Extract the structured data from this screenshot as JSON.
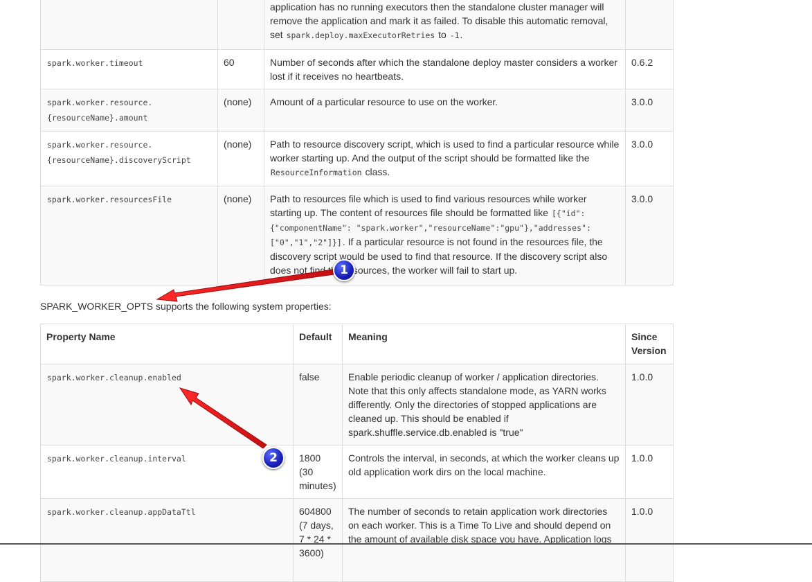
{
  "table1": {
    "partial_row": {
      "line1": "application has no running executors then the standalone cluster manager will",
      "line2": "remove the application and mark it as failed. To disable this automatic removal,",
      "set_word": "set",
      "code1": "spark.deploy.maxExecutorRetries",
      "to_word": "to",
      "code2": "-1",
      "end": "."
    },
    "rows": [
      {
        "name": "spark.worker.timeout",
        "default": "60",
        "meaning": "Number of seconds after which the standalone deploy master considers a worker lost if it receives no heartbeats.",
        "since": "0.6.2"
      },
      {
        "name_line1": "spark.worker.resource.",
        "name_line2": "{resourceName}.amount",
        "default": "(none)",
        "meaning": "Amount of a particular resource to use on the worker.",
        "since": "3.0.0"
      },
      {
        "name_line1": "spark.worker.resource.",
        "name_line2": "{resourceName}.discoveryScript",
        "default": "(none)",
        "meaning_before": "Path to resource discovery script, which is used to find a particular resource while worker starting up. And the output of the script should be formatted like the ",
        "meaning_code": "ResourceInformation",
        "meaning_after": " class.",
        "since": "3.0.0"
      },
      {
        "name": "spark.worker.resourcesFile",
        "default": "(none)",
        "meaning_before": "Path to resources file which is used to find various resources while worker starting up. The content of resources file should be formatted like ",
        "meaning_code": "[{\"id\":{\"componentName\": \"spark.worker\",\"resourceName\":\"gpu\"},\"addresses\":[\"0\",\"1\",\"2\"]}]",
        "meaning_after": ". If a particular resource is not found in the resources file, the discovery script would be used to find that resource. If the discovery script also does not find the resources, the worker will fail to start up.",
        "since": "3.0.0"
      }
    ]
  },
  "intro_text": "SPARK_WORKER_OPTS supports the following system properties:",
  "table2": {
    "headers": {
      "name": "Property Name",
      "default": "Default",
      "meaning": "Meaning",
      "since": "Since Version"
    },
    "rows": [
      {
        "name": "spark.worker.cleanup.enabled",
        "default": "false",
        "meaning": "Enable periodic cleanup of worker / application directories. Note that this only affects standalone mode, as YARN works differently. Only the directories of stopped applications are cleaned up. This should be enabled if spark.shuffle.service.db.enabled is \"true\"",
        "since": "1.0.0"
      },
      {
        "name": "spark.worker.cleanup.interval",
        "default": "1800 (30 minutes)",
        "meaning": "Controls the interval, in seconds, at which the worker cleans up old application work dirs on the local machine.",
        "since": "1.0.0"
      },
      {
        "name": "spark.worker.cleanup.appDataTtl",
        "default": "604800 (7 days, 7 * 24 * 3600)",
        "meaning": "The number of seconds to retain application work directories on each worker. This is a Time To Live and should depend on the amount of available disk space you have. Application logs",
        "since": "1.0.0"
      }
    ]
  },
  "annotations": {
    "badge1": "1",
    "badge2": "2",
    "arrow_color": "#e8141b",
    "badge_color": "#1a1fb8"
  }
}
